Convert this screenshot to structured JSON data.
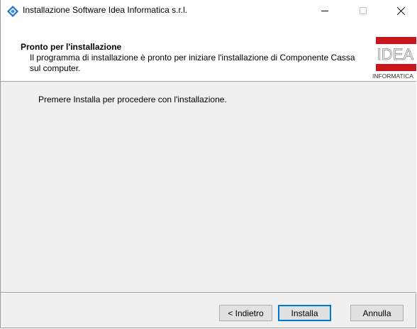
{
  "window": {
    "title": "Installazione Software Idea Informatica s.r.l.",
    "icons": {
      "app": "installer-diamond-icon",
      "minimize": "minimize-icon",
      "maximize": "maximize-icon",
      "close": "close-icon"
    }
  },
  "header": {
    "heading": "Pronto per l'installazione",
    "description": "Il programma di installazione è pronto per iniziare l'installazione di Componente Cassa sul computer.",
    "logo": {
      "top": "IDEA",
      "bottom": "INFORMATICA",
      "accent_color": "#c8161d"
    }
  },
  "content": {
    "message": "Premere Installa per procedere con l'installazione."
  },
  "buttons": {
    "back": "< Indietro",
    "install": "Installa",
    "cancel": "Annulla"
  }
}
